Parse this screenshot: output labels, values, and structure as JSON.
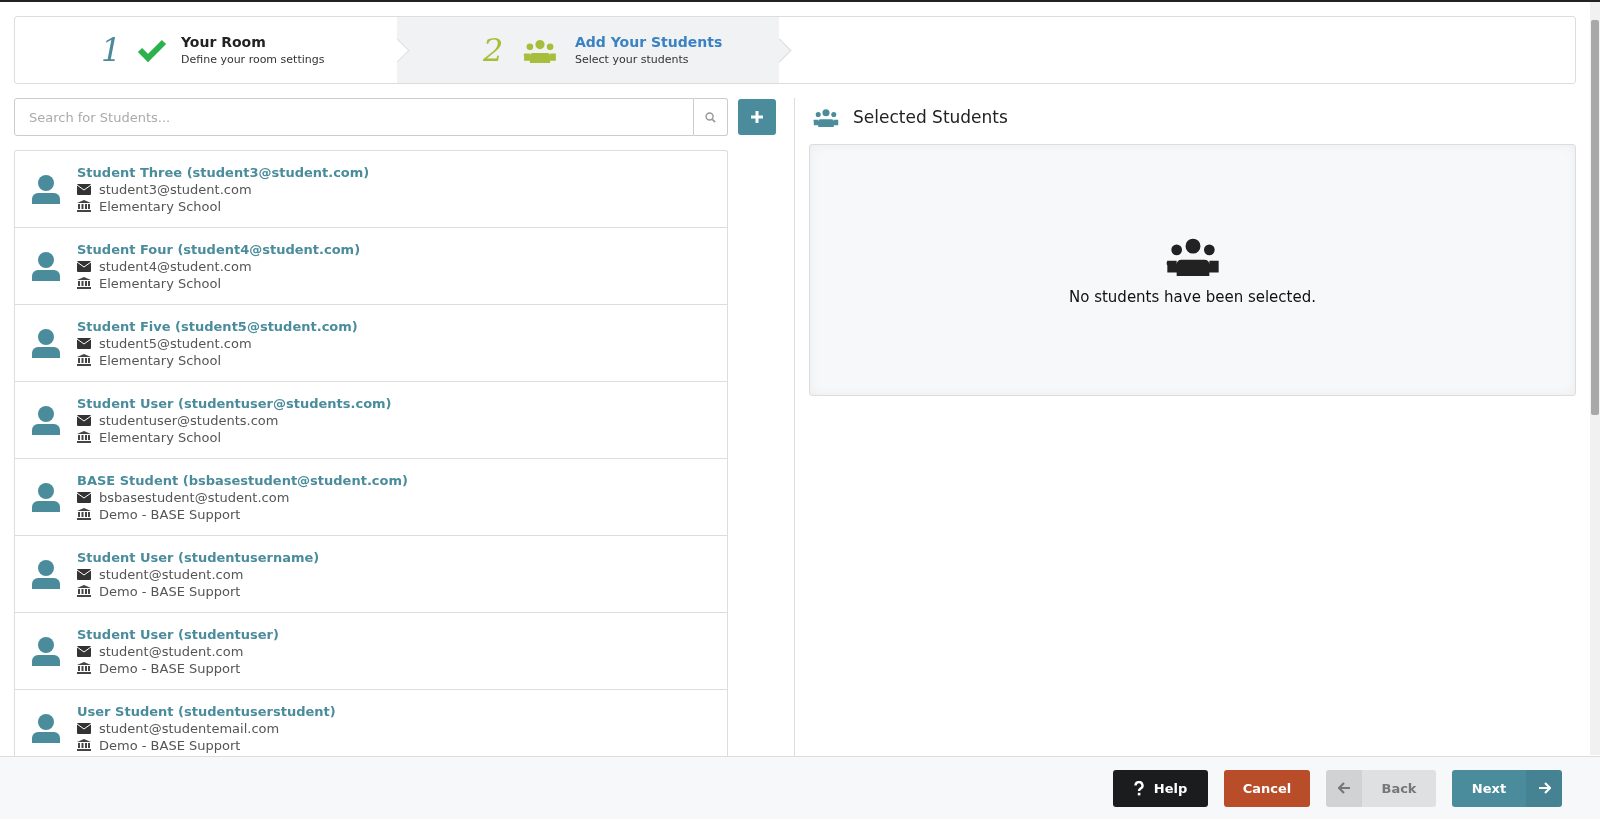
{
  "steps": [
    {
      "number": "1",
      "title": "Your Room",
      "subtitle": "Define your room settings",
      "selected": false,
      "done": true
    },
    {
      "number": "2",
      "title": "Add Your Students",
      "subtitle": "Select your students",
      "selected": true,
      "done": false
    }
  ],
  "search": {
    "placeholder": "Search for Students..."
  },
  "students": [
    {
      "name": "Student Three (student3@student.com)",
      "email": "student3@student.com",
      "school": "Elementary School"
    },
    {
      "name": "Student Four (student4@student.com)",
      "email": "student4@student.com",
      "school": "Elementary School"
    },
    {
      "name": "Student Five (student5@student.com)",
      "email": "student5@student.com",
      "school": "Elementary School"
    },
    {
      "name": "Student User (studentuser@students.com)",
      "email": "studentuser@students.com",
      "school": "Elementary School"
    },
    {
      "name": "BASE Student (bsbasestudent@student.com)",
      "email": "bsbasestudent@student.com",
      "school": "Demo - BASE Support"
    },
    {
      "name": "Student User (studentusername)",
      "email": "student@student.com",
      "school": "Demo - BASE Support"
    },
    {
      "name": "Student User (studentuser)",
      "email": "student@student.com",
      "school": "Demo - BASE Support"
    },
    {
      "name": "User Student (studentuserstudent)",
      "email": "student@studentemail.com",
      "school": "Demo - BASE Support"
    }
  ],
  "selected_panel": {
    "title": "Selected Students",
    "empty_message": "No students have been selected."
  },
  "footer_buttons": [
    {
      "kind": "help",
      "label": "Help",
      "disabled": false
    },
    {
      "kind": "cancel",
      "label": "Cancel",
      "disabled": false
    },
    {
      "kind": "back",
      "label": "Back",
      "disabled": true
    },
    {
      "kind": "next",
      "label": "Next",
      "disabled": false
    }
  ]
}
